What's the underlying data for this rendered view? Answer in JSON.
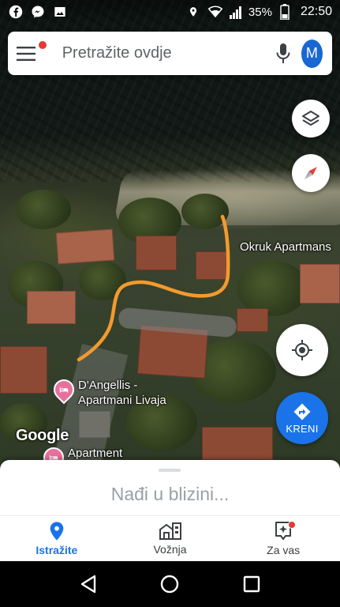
{
  "status_bar": {
    "battery_percent": "35%",
    "time": "22:50",
    "left_icons": [
      "facebook-icon",
      "messenger-icon",
      "gallery-icon"
    ],
    "right_icons": [
      "location-icon",
      "wifi-icon",
      "signal-icon",
      "battery-icon"
    ]
  },
  "search": {
    "placeholder": "Pretražite ovdje",
    "avatar_letter": "M"
  },
  "map": {
    "labels": {
      "okruk": "Okruk Apartmans",
      "dangellis": "D'Angellis -\nApartmani Livaja",
      "apartment": "Apartment"
    },
    "logo": "Google",
    "route_color": "#f39a2e",
    "style": "satellite"
  },
  "buttons": {
    "go_label": "KRENI"
  },
  "sheet": {
    "nearby_label": "Nađi u blizini..."
  },
  "bottom_nav": {
    "items": [
      {
        "label": "Istražite",
        "icon": "pin-icon",
        "active": true
      },
      {
        "label": "Vožnja",
        "icon": "commute-icon",
        "active": false
      },
      {
        "label": "Za vas",
        "icon": "for-you-icon",
        "active": false
      }
    ]
  },
  "colors": {
    "accent": "#1a73e8",
    "notification_dot": "#e53935",
    "place_pin": "#e8709d"
  }
}
